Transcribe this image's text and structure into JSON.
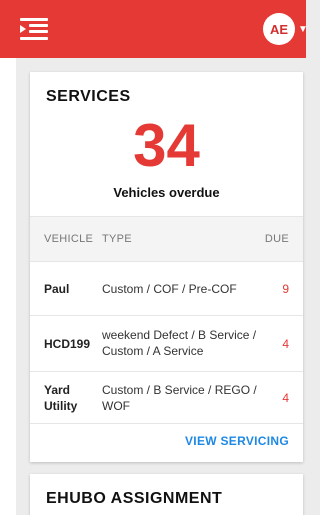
{
  "header": {
    "avatar_initials": "AE",
    "brand_color": "#e53935",
    "menu_icon": "menu-collapse-icon",
    "chevron_icon": "chevron-down-icon"
  },
  "services": {
    "title": "SERVICES",
    "overdue_count": "34",
    "overdue_caption": "Vehicles overdue",
    "columns": {
      "vehicle": "VEHICLE",
      "type": "TYPE",
      "due": "DUE"
    },
    "rows": [
      {
        "vehicle": "Paul",
        "type": "Custom / COF / Pre-COF",
        "due": "9"
      },
      {
        "vehicle": "HCD199",
        "type": "weekend Defect / B Service / Custom / A Service",
        "due": "4"
      },
      {
        "vehicle": "Yard Utility",
        "type": "Custom / B Service / REGO / WOF",
        "due": "4"
      }
    ],
    "view_link": "VIEW SERVICING",
    "due_color": "#e53935",
    "link_color": "#1e88e5"
  },
  "ehubo": {
    "title": "EHUBO ASSIGNMENT"
  }
}
